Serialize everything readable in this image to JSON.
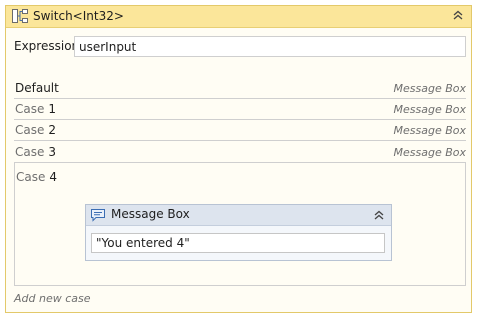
{
  "activity": {
    "title": "Switch<Int32>",
    "expression_label": "Expression",
    "expression_value": "userInput"
  },
  "rows": {
    "default": {
      "label": "Default",
      "activity": "Message Box"
    },
    "case1": {
      "word": "Case",
      "num": "1",
      "activity": "Message Box"
    },
    "case2": {
      "word": "Case",
      "num": "2",
      "activity": "Message Box"
    },
    "case3": {
      "word": "Case",
      "num": "3",
      "activity": "Message Box"
    },
    "case4": {
      "word": "Case",
      "num": "4"
    }
  },
  "message_box": {
    "title": "Message Box",
    "text_value": "\"You entered 4\""
  },
  "footer": {
    "add_case_label": "Add new case"
  },
  "colors": {
    "activity_header": "#fbe69a",
    "activity_border": "#e3c96a",
    "message_header": "#dde4ee",
    "message_border": "#b8c3d3"
  },
  "icons": {
    "activity": "switch-icon",
    "collapse": "double-chevron-up-icon",
    "message": "message-bubble-icon"
  }
}
